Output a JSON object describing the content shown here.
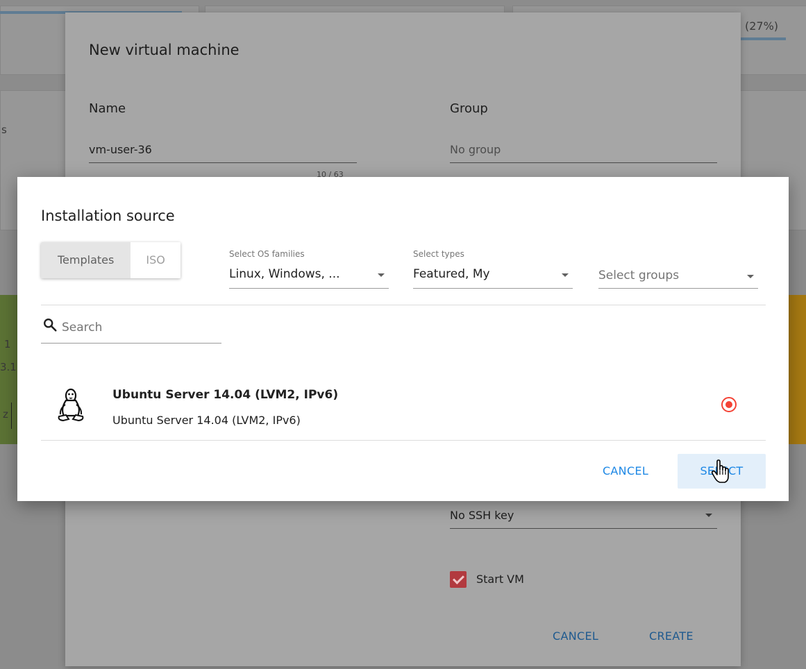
{
  "background": {
    "progress_text": "(27%)",
    "fragments": [
      "s",
      "1",
      "3.1",
      "z"
    ]
  },
  "vm_dialog": {
    "title": "New virtual machine",
    "name_label": "Name",
    "name_value": "vm-user-36",
    "name_counter": "10 / 63",
    "group_label": "Group",
    "group_placeholder": "No group",
    "ssh_value": "No SSH key",
    "start_vm_label": "Start VM",
    "start_vm_checked": true,
    "cancel_label": "CANCEL",
    "create_label": "CREATE"
  },
  "source_dialog": {
    "title": "Installation source",
    "tabs": [
      {
        "label": "Templates",
        "active": true
      },
      {
        "label": "ISO",
        "active": false
      }
    ],
    "os_families": {
      "label": "Select OS families",
      "value": "Linux, Windows, ..."
    },
    "types": {
      "label": "Select types",
      "value": "Featured, My"
    },
    "groups": {
      "placeholder": "Select groups"
    },
    "search": {
      "placeholder": "Search"
    },
    "templates": [
      {
        "name": "Ubuntu Server 14.04 (LVM2, IPv6)",
        "description": "Ubuntu Server 14.04 (LVM2, IPv6)",
        "icon": "linux-tux-icon",
        "selected": true
      }
    ],
    "cancel_label": "CANCEL",
    "select_label": "SELECT"
  },
  "colors": {
    "accent": "#1e88e5",
    "radio": "#f44336",
    "checkbox": "#b23a3f"
  }
}
